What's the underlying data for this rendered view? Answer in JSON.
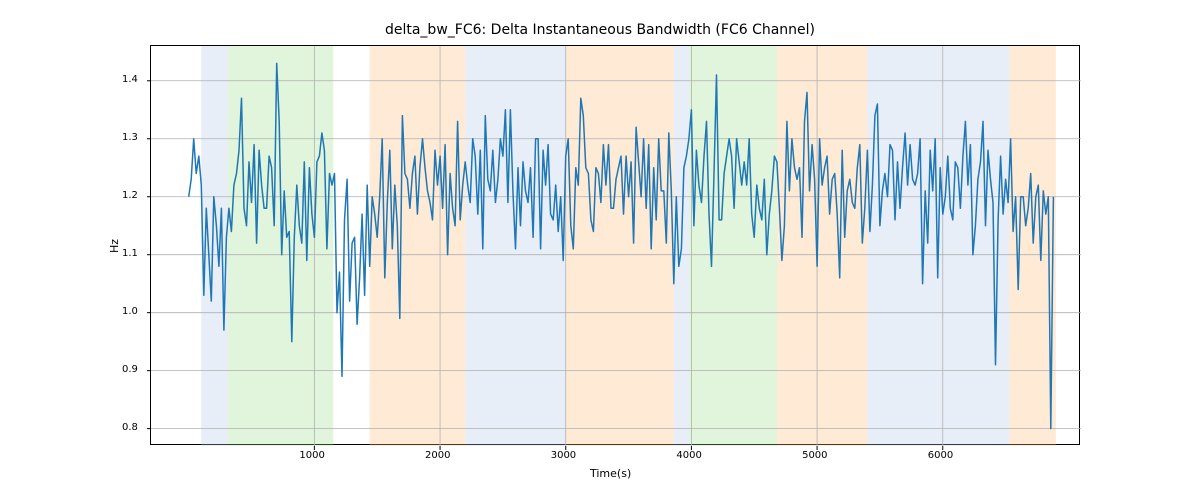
{
  "chart_data": {
    "type": "line",
    "title": "delta_bw_FC6: Delta Instantaneous Bandwidth (FC6 Channel)",
    "xlabel": "Time(s)",
    "ylabel": "Hz",
    "xlim": [
      -300,
      7100
    ],
    "ylim": [
      0.77,
      1.46
    ],
    "xticks": [
      1000,
      2000,
      3000,
      4000,
      5000,
      6000
    ],
    "yticks": [
      0.8,
      0.9,
      1.0,
      1.1,
      1.2,
      1.3,
      1.4
    ],
    "grid": true,
    "dx": 20,
    "series": [
      {
        "name": "delta_bw_FC6",
        "color": "#1f77b4",
        "values": [
          1.2,
          1.23,
          1.3,
          1.24,
          1.27,
          1.22,
          1.03,
          1.18,
          1.1,
          1.02,
          1.2,
          1.15,
          1.08,
          1.18,
          0.97,
          1.13,
          1.18,
          1.14,
          1.22,
          1.24,
          1.28,
          1.37,
          1.18,
          1.15,
          1.26,
          1.19,
          1.29,
          1.12,
          1.28,
          1.22,
          1.18,
          1.18,
          1.27,
          1.25,
          1.15,
          1.43,
          1.33,
          1.1,
          1.21,
          1.13,
          1.14,
          0.95,
          1.13,
          1.22,
          1.15,
          1.12,
          1.26,
          1.09,
          1.25,
          1.17,
          1.13,
          1.26,
          1.27,
          1.31,
          1.28,
          1.11,
          1.24,
          1.22,
          1.24,
          1.0,
          1.07,
          0.89,
          1.16,
          1.23,
          1.02,
          1.12,
          1.13,
          0.98,
          1.06,
          1.17,
          1.03,
          1.22,
          1.08,
          1.2,
          1.17,
          1.13,
          1.2,
          1.3,
          1.06,
          1.19,
          1.28,
          1.11,
          1.22,
          1.15,
          0.99,
          1.34,
          1.24,
          1.23,
          1.18,
          1.24,
          1.27,
          1.17,
          1.25,
          1.3,
          1.25,
          1.21,
          1.19,
          1.16,
          1.28,
          1.22,
          1.27,
          1.18,
          1.29,
          1.1,
          1.24,
          1.18,
          1.15,
          1.33,
          1.16,
          1.22,
          1.26,
          1.22,
          1.19,
          1.3,
          1.27,
          1.17,
          1.28,
          1.11,
          1.34,
          1.23,
          1.21,
          1.28,
          1.19,
          1.23,
          1.3,
          1.27,
          1.35,
          1.19,
          1.35,
          1.21,
          1.11,
          1.25,
          1.15,
          1.26,
          1.21,
          1.19,
          1.25,
          1.13,
          1.3,
          1.3,
          1.11,
          1.28,
          1.22,
          1.29,
          1.17,
          1.16,
          1.22,
          1.14,
          1.2,
          1.09,
          1.27,
          1.3,
          1.15,
          1.11,
          1.25,
          1.22,
          1.37,
          1.34,
          1.25,
          1.24,
          1.16,
          1.14,
          1.25,
          1.24,
          1.19,
          1.29,
          1.22,
          1.29,
          1.18,
          1.18,
          1.23,
          1.25,
          1.27,
          1.17,
          1.27,
          1.2,
          1.26,
          1.12,
          1.32,
          1.26,
          1.2,
          1.3,
          1.18,
          1.29,
          1.11,
          1.25,
          1.16,
          1.3,
          1.21,
          1.21,
          1.12,
          1.31,
          1.21,
          1.05,
          1.2,
          1.08,
          1.11,
          1.25,
          1.27,
          1.3,
          1.35,
          1.15,
          1.28,
          1.22,
          1.19,
          1.27,
          1.33,
          1.17,
          1.08,
          1.24,
          1.41,
          1.16,
          1.16,
          1.24,
          1.27,
          1.3,
          1.27,
          1.18,
          1.3,
          1.26,
          1.22,
          1.26,
          1.22,
          1.3,
          1.17,
          1.13,
          1.22,
          1.18,
          1.16,
          1.23,
          1.1,
          1.17,
          1.21,
          1.27,
          1.26,
          1.18,
          1.09,
          1.15,
          1.33,
          1.21,
          1.3,
          1.25,
          1.23,
          1.25,
          1.13,
          1.33,
          1.38,
          1.21,
          1.29,
          1.23,
          1.08,
          1.3,
          1.22,
          1.25,
          1.27,
          1.17,
          1.23,
          1.24,
          1.17,
          1.06,
          1.28,
          1.13,
          1.21,
          1.23,
          1.19,
          1.18,
          1.25,
          1.29,
          1.12,
          1.18,
          1.28,
          1.14,
          1.22,
          1.34,
          1.36,
          1.15,
          1.21,
          1.24,
          1.2,
          1.29,
          1.28,
          1.16,
          1.26,
          1.18,
          1.25,
          1.31,
          1.22,
          1.29,
          1.23,
          1.22,
          1.24,
          1.3,
          1.05,
          1.21,
          1.12,
          1.28,
          1.21,
          1.3,
          1.06,
          1.25,
          1.17,
          1.2,
          1.27,
          1.18,
          1.16,
          1.26,
          1.25,
          1.18,
          1.27,
          1.33,
          1.22,
          1.29,
          1.1,
          1.15,
          1.23,
          1.26,
          1.33,
          1.15,
          1.28,
          1.23,
          1.19,
          0.91,
          1.16,
          1.27,
          1.17,
          1.23,
          1.19,
          1.3,
          1.14,
          1.2,
          1.04,
          1.2,
          1.2,
          1.15,
          1.18,
          1.24,
          1.12,
          1.2,
          1.22,
          1.09,
          1.21,
          1.17,
          1.2,
          0.8,
          1.2
        ]
      }
    ],
    "bands": [
      {
        "start": 100,
        "end": 310,
        "style": "blue"
      },
      {
        "start": 310,
        "end": 1150,
        "style": "green"
      },
      {
        "start": 1440,
        "end": 2200,
        "style": "peach"
      },
      {
        "start": 2200,
        "end": 3000,
        "style": "blue"
      },
      {
        "start": 3000,
        "end": 3860,
        "style": "peach"
      },
      {
        "start": 3860,
        "end": 3980,
        "style": "blue"
      },
      {
        "start": 3980,
        "end": 4680,
        "style": "green"
      },
      {
        "start": 4680,
        "end": 5000,
        "style": "peach"
      },
      {
        "start": 5000,
        "end": 5400,
        "style": "peach"
      },
      {
        "start": 5400,
        "end": 6450,
        "style": "blue"
      },
      {
        "start": 6450,
        "end": 6530,
        "style": "blue"
      },
      {
        "start": 6530,
        "end": 6900,
        "style": "peach"
      }
    ]
  },
  "layout": {
    "axes_left": 150,
    "axes_top": 45,
    "axes_width": 930,
    "axes_height": 400
  }
}
